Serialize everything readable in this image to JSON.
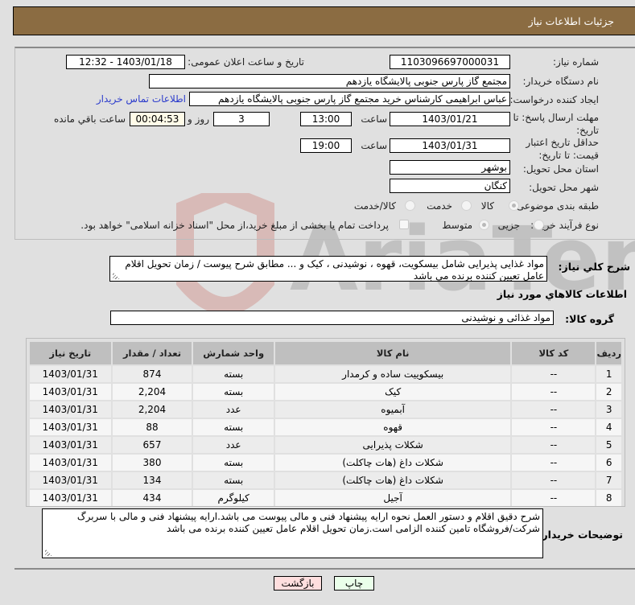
{
  "header": {
    "title": "جزئیات اطلاعات نیاز"
  },
  "form": {
    "need_number_label": "شماره نیاز:",
    "need_number": "1103096697000031",
    "announce_label": "تاریخ و ساعت اعلان عمومی:",
    "announce_value": "1403/01/18 - 12:32",
    "buyer_org_label": "نام دستگاه خریدار:",
    "buyer_org": "مجتمع گاز پارس جنوبی  پالایشگاه یازدهم",
    "creator_label": "ایجاد کننده درخواست:",
    "creator": "عباس ابراهیمی کارشناس خرید مجتمع گاز پارس جنوبی  پالایشگاه یازدهم",
    "contact_link": "اطلاعات تماس خریدار",
    "deadline_label": "مهلت ارسال پاسخ: تا تاریخ:",
    "deadline_date": "1403/01/21",
    "time_label": "ساعت",
    "deadline_time": "13:00",
    "days_remaining": "3",
    "days_label": "روز و",
    "time_remaining": "00:04:53",
    "remaining_label": "ساعت باقي مانده",
    "price_validity_label": "حداقل تاریخ اعتبار قیمت: تا تاریخ:",
    "price_validity_date": "1403/01/31",
    "price_validity_time": "19:00",
    "province_label": "استان محل تحویل:",
    "province": "بوشهر",
    "city_label": "شهر محل تحویل:",
    "city": "کنگان",
    "category_label": "طبقه بندی موضوعی:",
    "category_options": [
      "کالا",
      "خدمت",
      "کالا/خدمت"
    ],
    "category_selected": "کالا",
    "process_label": "نوع فرآیند خرید :",
    "process_options": [
      "جزیی",
      "متوسط"
    ],
    "process_selected": "متوسط",
    "payment_note": "پرداخت تمام یا بخشی از مبلغ خرید،از محل \"اسناد خزانه اسلامی\" خواهد بود."
  },
  "description": {
    "label": "شرح کلي نياز:",
    "text": "مواد غذایی پذیرایی شامل بیسکویت، قهوه ، نوشیدنی ، کیک و ... مطابق شرح پیوست / زمان تحویل اقلام عامل تعیین کننده برنده می باشد"
  },
  "goods": {
    "section_title": "اطلاعات کالاهاي مورد نياز",
    "group_label": "گروه کالا:",
    "group_value": "مواد غذائی و نوشیدنی",
    "columns": [
      "ردیف",
      "کد کالا",
      "نام کالا",
      "واحد شمارش",
      "تعداد / مقدار",
      "تاریخ نیاز"
    ],
    "rows": [
      {
        "row": "1",
        "code": "--",
        "name": "بیسکوییت ساده و کرمدار",
        "unit": "بسته",
        "qty": "874",
        "date": "1403/01/31"
      },
      {
        "row": "2",
        "code": "--",
        "name": "کیک",
        "unit": "بسته",
        "qty": "2,204",
        "date": "1403/01/31"
      },
      {
        "row": "3",
        "code": "--",
        "name": "آبمیوه",
        "unit": "عدد",
        "qty": "2,204",
        "date": "1403/01/31"
      },
      {
        "row": "4",
        "code": "--",
        "name": "قهوه",
        "unit": "بسته",
        "qty": "88",
        "date": "1403/01/31"
      },
      {
        "row": "5",
        "code": "--",
        "name": "شکلات پذیرایی",
        "unit": "عدد",
        "qty": "657",
        "date": "1403/01/31"
      },
      {
        "row": "6",
        "code": "--",
        "name": "شکلات داغ (هات چاکلت)",
        "unit": "بسته",
        "qty": "380",
        "date": "1403/01/31"
      },
      {
        "row": "7",
        "code": "--",
        "name": "شکلات داغ (هات چاکلت)",
        "unit": "بسته",
        "qty": "134",
        "date": "1403/01/31"
      },
      {
        "row": "8",
        "code": "--",
        "name": "آجیل",
        "unit": "کیلوگرم",
        "qty": "434",
        "date": "1403/01/31"
      }
    ]
  },
  "buyer_notes": {
    "label": "توضیحات خریدار:",
    "text": "شرح دقیق اقلام و دستور العمل نحوه ارایه پیشنهاد فنی و مالی پیوست می باشد.ارایه پیشنهاد فنی و مالی با سربرگ شرکت/فروشگاه تامین کننده الزامی است.زمان تحویل اقلام عامل تعیین کننده برنده می باشد"
  },
  "buttons": {
    "print": "چاپ",
    "back": "بازگشت"
  },
  "colors": {
    "header_bg": "#8b6c42",
    "print_bg": "#eaffea",
    "back_bg": "#ffdede",
    "link": "#2b3bcc"
  }
}
